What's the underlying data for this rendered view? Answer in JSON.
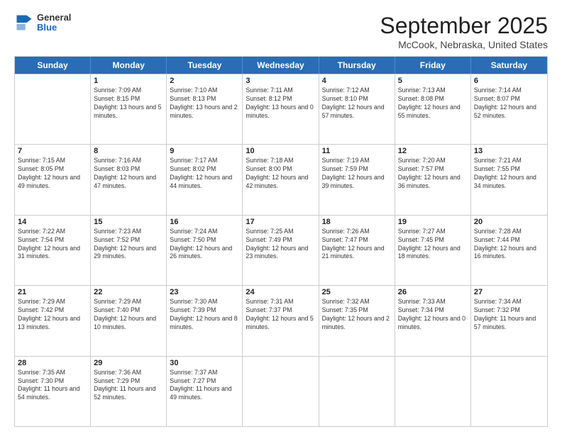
{
  "header": {
    "logo": {
      "general": "General",
      "blue": "Blue"
    },
    "month": "September 2025",
    "location": "McCook, Nebraska, United States"
  },
  "days_of_week": [
    "Sunday",
    "Monday",
    "Tuesday",
    "Wednesday",
    "Thursday",
    "Friday",
    "Saturday"
  ],
  "weeks": [
    [
      {
        "day": "",
        "empty": true
      },
      {
        "day": "1",
        "sunrise": "7:09 AM",
        "sunset": "8:15 PM",
        "daylight": "13 hours and 5 minutes."
      },
      {
        "day": "2",
        "sunrise": "7:10 AM",
        "sunset": "8:13 PM",
        "daylight": "13 hours and 2 minutes."
      },
      {
        "day": "3",
        "sunrise": "7:11 AM",
        "sunset": "8:12 PM",
        "daylight": "13 hours and 0 minutes."
      },
      {
        "day": "4",
        "sunrise": "7:12 AM",
        "sunset": "8:10 PM",
        "daylight": "12 hours and 57 minutes."
      },
      {
        "day": "5",
        "sunrise": "7:13 AM",
        "sunset": "8:08 PM",
        "daylight": "12 hours and 55 minutes."
      },
      {
        "day": "6",
        "sunrise": "7:14 AM",
        "sunset": "8:07 PM",
        "daylight": "12 hours and 52 minutes."
      }
    ],
    [
      {
        "day": "7",
        "sunrise": "7:15 AM",
        "sunset": "8:05 PM",
        "daylight": "12 hours and 49 minutes."
      },
      {
        "day": "8",
        "sunrise": "7:16 AM",
        "sunset": "8:03 PM",
        "daylight": "12 hours and 47 minutes."
      },
      {
        "day": "9",
        "sunrise": "7:17 AM",
        "sunset": "8:02 PM",
        "daylight": "12 hours and 44 minutes."
      },
      {
        "day": "10",
        "sunrise": "7:18 AM",
        "sunset": "8:00 PM",
        "daylight": "12 hours and 42 minutes."
      },
      {
        "day": "11",
        "sunrise": "7:19 AM",
        "sunset": "7:59 PM",
        "daylight": "12 hours and 39 minutes."
      },
      {
        "day": "12",
        "sunrise": "7:20 AM",
        "sunset": "7:57 PM",
        "daylight": "12 hours and 36 minutes."
      },
      {
        "day": "13",
        "sunrise": "7:21 AM",
        "sunset": "7:55 PM",
        "daylight": "12 hours and 34 minutes."
      }
    ],
    [
      {
        "day": "14",
        "sunrise": "7:22 AM",
        "sunset": "7:54 PM",
        "daylight": "12 hours and 31 minutes."
      },
      {
        "day": "15",
        "sunrise": "7:23 AM",
        "sunset": "7:52 PM",
        "daylight": "12 hours and 29 minutes."
      },
      {
        "day": "16",
        "sunrise": "7:24 AM",
        "sunset": "7:50 PM",
        "daylight": "12 hours and 26 minutes."
      },
      {
        "day": "17",
        "sunrise": "7:25 AM",
        "sunset": "7:49 PM",
        "daylight": "12 hours and 23 minutes."
      },
      {
        "day": "18",
        "sunrise": "7:26 AM",
        "sunset": "7:47 PM",
        "daylight": "12 hours and 21 minutes."
      },
      {
        "day": "19",
        "sunrise": "7:27 AM",
        "sunset": "7:45 PM",
        "daylight": "12 hours and 18 minutes."
      },
      {
        "day": "20",
        "sunrise": "7:28 AM",
        "sunset": "7:44 PM",
        "daylight": "12 hours and 16 minutes."
      }
    ],
    [
      {
        "day": "21",
        "sunrise": "7:29 AM",
        "sunset": "7:42 PM",
        "daylight": "12 hours and 13 minutes."
      },
      {
        "day": "22",
        "sunrise": "7:29 AM",
        "sunset": "7:40 PM",
        "daylight": "12 hours and 10 minutes."
      },
      {
        "day": "23",
        "sunrise": "7:30 AM",
        "sunset": "7:39 PM",
        "daylight": "12 hours and 8 minutes."
      },
      {
        "day": "24",
        "sunrise": "7:31 AM",
        "sunset": "7:37 PM",
        "daylight": "12 hours and 5 minutes."
      },
      {
        "day": "25",
        "sunrise": "7:32 AM",
        "sunset": "7:35 PM",
        "daylight": "12 hours and 2 minutes."
      },
      {
        "day": "26",
        "sunrise": "7:33 AM",
        "sunset": "7:34 PM",
        "daylight": "12 hours and 0 minutes."
      },
      {
        "day": "27",
        "sunrise": "7:34 AM",
        "sunset": "7:32 PM",
        "daylight": "11 hours and 57 minutes."
      }
    ],
    [
      {
        "day": "28",
        "sunrise": "7:35 AM",
        "sunset": "7:30 PM",
        "daylight": "11 hours and 54 minutes."
      },
      {
        "day": "29",
        "sunrise": "7:36 AM",
        "sunset": "7:29 PM",
        "daylight": "11 hours and 52 minutes."
      },
      {
        "day": "30",
        "sunrise": "7:37 AM",
        "sunset": "7:27 PM",
        "daylight": "11 hours and 49 minutes."
      },
      {
        "day": "",
        "empty": true
      },
      {
        "day": "",
        "empty": true
      },
      {
        "day": "",
        "empty": true
      },
      {
        "day": "",
        "empty": true
      }
    ]
  ]
}
